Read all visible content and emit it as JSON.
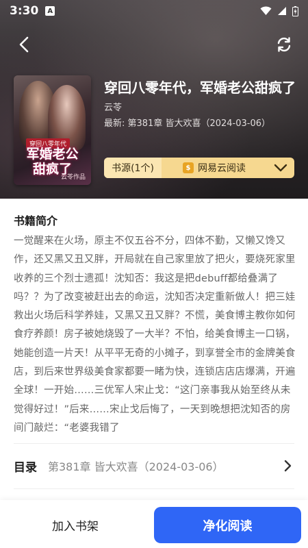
{
  "status_bar": {
    "time": "3:30",
    "notification_icon": "A"
  },
  "header": {
    "back_icon": "chevron-left-icon",
    "refresh_icon": "refresh-icon"
  },
  "book": {
    "title": "穿回八零年代，军婚老公甜疯了",
    "author": "云苓",
    "latest": "最新: 第381章 皆大欢喜（2024-03-06）",
    "cover": {
      "tag": "穿回八零年代",
      "title_line1": "军婚老公",
      "title_line2": "甜疯了",
      "author": "云苓作品"
    }
  },
  "source": {
    "label": "书源(1个)",
    "name": "网易云阅读",
    "badge_icon": "coin-icon"
  },
  "intro": {
    "heading": "书籍简介",
    "text": "一觉醒来在火场，原主不仅五谷不分，四体不勤，又懒又馋又作，还又黑又丑又胖，开局就在自己家里放了把火，要烧死家里收养的三个烈士遗孤！沈知否：我这是把debuff都给叠满了吗？？为了改变被赶出去的命运，沈知否决定重新做人！把三娃救出火场后科学养娃，又黑又丑又胖？不慌，美食博主教你如何食疗养颜！房子被她烧毁了一大半？不怕，给美食博主一口锅，她能创造一片天！从平平无奇的小摊子，到享誉全市的金牌美食店，到后来世界级美食家都要一睹为快，连锁店店店爆满，开遍全球！一开始……三优军人宋止戈：“这门亲事我从始至终从未觉得好过！”后来……宋止戈后悔了，一天到晚想把沈知否的房间门敲烂：“老婆我错了"
  },
  "toc": {
    "label": "目录",
    "chapter": "第381章 皆大欢喜（2024-03-06）"
  },
  "actions": {
    "add_shelf": "加入书架",
    "read": "净化阅读"
  },
  "colors": {
    "primary": "#2f66f6",
    "source_bg": "#f6d890"
  }
}
